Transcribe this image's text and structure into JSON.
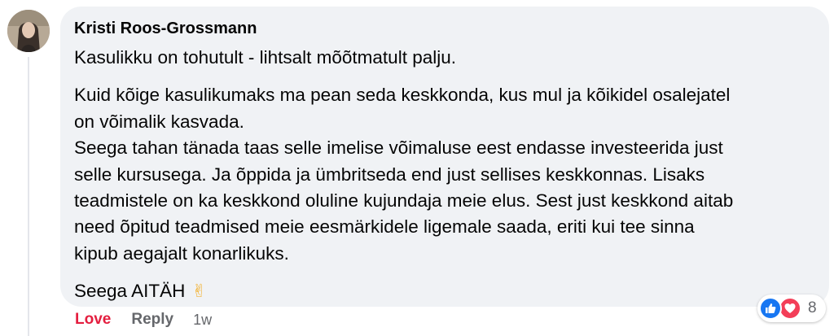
{
  "comment": {
    "author": "Kristi Roos-Grossmann",
    "paragraphs": [
      [
        "Kasulikku on tohutult - lihtsalt mõõtmatult palju."
      ],
      [
        "Kuid kõige kasulikumaks ma pean seda keskkonda, kus mul ja kõikidel osalejatel",
        "on võimalik kasvada.",
        "Seega tahan tänada taas selle imelise võimaluse eest endasse investeerida just",
        "selle kursusega. Ja õppida ja ümbritseda end just sellises keskkonnas. Lisaks",
        "teadmistele on ka keskkond oluline kujundaja meie elus. Sest just keskkond aitab",
        "need õpitud teadmised meie eesmärkidele ligemale saada, eriti kui tee sinna",
        "kipub aegajalt konarlikuks."
      ],
      [
        "Seega AITÄH"
      ]
    ],
    "emoji": "✌",
    "emoji_icon": "victory-hand-icon"
  },
  "actions": {
    "love_label": "Love",
    "reply_label": "Reply",
    "timestamp": "1w"
  },
  "reactions": {
    "icons": [
      "like-icon",
      "love-icon"
    ],
    "count": "8"
  },
  "colors": {
    "bubble_bg": "#f0f2f5",
    "love_red": "#e41e3f",
    "like_blue": "#1877f2",
    "heart_red": "#f33e58",
    "muted_text": "#65676b"
  }
}
